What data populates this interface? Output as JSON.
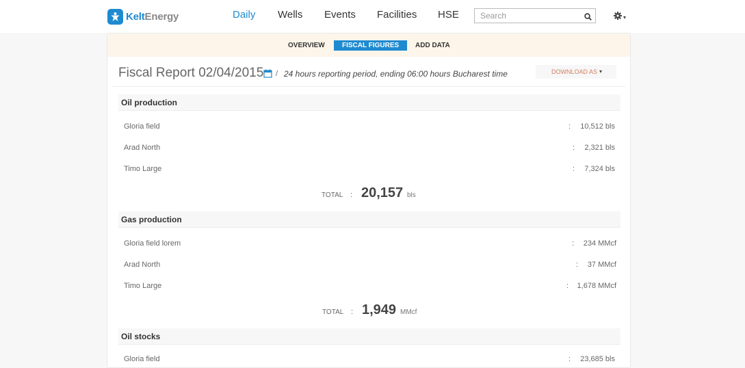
{
  "brand": {
    "name_a": "Kelt",
    "name_b": "Energy",
    "accent": "#1e8ad0"
  },
  "nav": {
    "items": [
      {
        "label": "Daily",
        "active": true
      },
      {
        "label": "Wells"
      },
      {
        "label": "Events"
      },
      {
        "label": "Facilities"
      },
      {
        "label": "HSE"
      }
    ]
  },
  "search": {
    "placeholder": "Search",
    "icon": "search-icon"
  },
  "settings": {
    "icon": "gear-icon",
    "caret": "▾"
  },
  "subnav": {
    "tabs": [
      {
        "label": "OVERVIEW"
      },
      {
        "label": "FISCAL FIGURES",
        "active": true
      },
      {
        "label": "ADD DATA"
      }
    ]
  },
  "report": {
    "title": "Fiscal Report 02/04/2015",
    "separator": "/",
    "period": "24 hours reporting period, ending 06:00 hours Bucharest time",
    "download_label": "DOWNLOAD AS",
    "download_caret": "▾"
  },
  "sections": [
    {
      "title": "Oil production",
      "rows": [
        {
          "label": "Gloria field",
          "value": "10,512 bls"
        },
        {
          "label": "Arad North",
          "value": "2,321 bls"
        },
        {
          "label": "Timo Large",
          "value": "7,324 bls"
        }
      ],
      "total_label": "TOTAL",
      "total_value": "20,157",
      "total_unit": "bls"
    },
    {
      "title": "Gas production",
      "rows": [
        {
          "label": "Gloria field lorem",
          "value": "234 MMcf"
        },
        {
          "label": "Arad North",
          "value": "37 MMcf"
        },
        {
          "label": "Timo Large",
          "value": "1,678 MMcf"
        }
      ],
      "total_label": "TOTAL",
      "total_value": "1,949",
      "total_unit": "MMcf"
    },
    {
      "title": "Oil stocks",
      "rows": [
        {
          "label": "Gloria field",
          "value": "23,685 bls"
        }
      ]
    }
  ],
  "colon": ":"
}
